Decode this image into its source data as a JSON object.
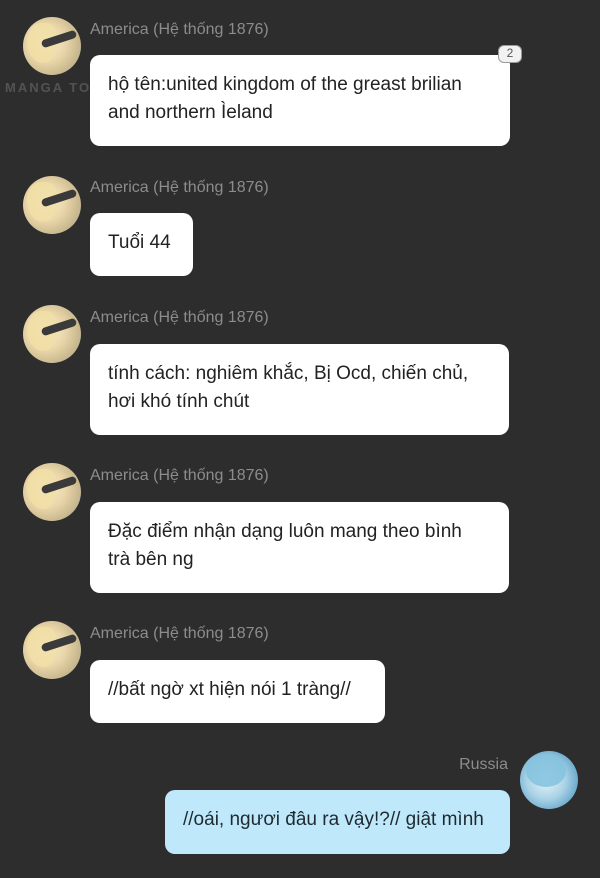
{
  "watermark": "MANGA TOON",
  "messages": [
    {
      "sender": "America (Hệ thống 1876)",
      "side": "left",
      "lines": [
        "hộ tên:united kingdom of the greast brilian",
        "and northern Ìeland"
      ],
      "badge": "2"
    },
    {
      "sender": "America (Hệ thống 1876)",
      "side": "left",
      "lines": [
        "Tuổi 44"
      ]
    },
    {
      "sender": "America (Hệ thống 1876)",
      "side": "left",
      "lines": [
        "tính cách: nghiêm khắc, Bị Ocd, chiến chủ,",
        "hơi khó tính chút"
      ]
    },
    {
      "sender": "America (Hệ thống 1876)",
      "side": "left",
      "lines": [
        "Đặc điểm nhận dạng luôn mang theo bình",
        "trà bên ng"
      ]
    },
    {
      "sender": "America (Hệ thống 1876)",
      "side": "left",
      "lines": [
        "//bất ngờ xt hiện nói 1 tràng//"
      ]
    },
    {
      "sender": "Russia",
      "side": "right",
      "lines": [
        "//oái, ngươi đâu ra vậy!?// giật mình"
      ]
    }
  ],
  "colors": {
    "background": "#2d2d2d",
    "bubble_left": "#ffffff",
    "bubble_right": "#bfe9fb",
    "sender_text": "#8c8c8c"
  }
}
